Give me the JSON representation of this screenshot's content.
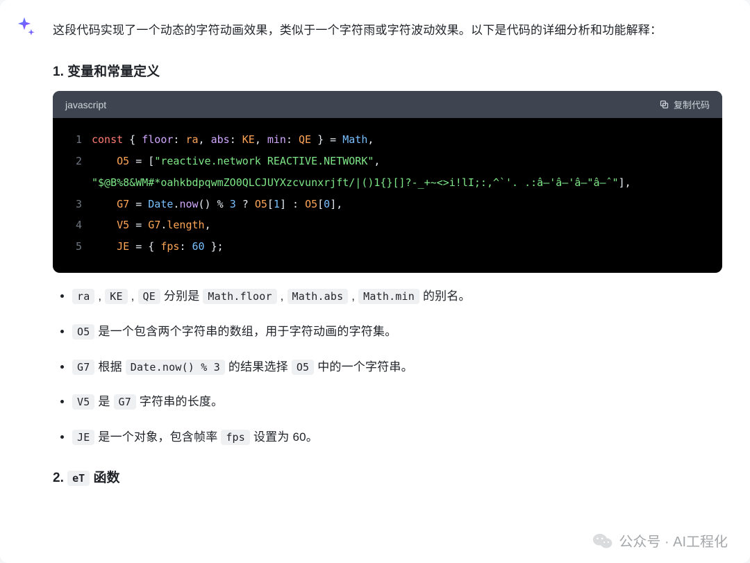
{
  "intro": "这段代码实现了一个动态的字符动画效果，类似于一个字符雨或字符波动效果。以下是代码的详细分析和功能解释：",
  "sections": {
    "s1": {
      "prefix": "1. ",
      "title": "变量和常量定义"
    },
    "s2": {
      "prefix": "2. ",
      "code": "eT",
      "suffix": " 函数"
    }
  },
  "code": {
    "lang": "javascript",
    "copy_label": "复制代码",
    "lines": {
      "l1": {
        "n": "1"
      },
      "l2": {
        "n": "2"
      },
      "l3": {
        "n": "3"
      },
      "l4": {
        "n": "4"
      },
      "l5": {
        "n": "5"
      }
    },
    "tokens": {
      "const": "const",
      "lbrace_sp": " { ",
      "floor": "floor",
      "colon_sp": ": ",
      "ra": "ra",
      "comma_sp": ", ",
      "abs": "abs",
      "KE": "KE",
      "min": "min",
      "QE": "QE",
      "rbrace_eq": " } = ",
      "Math": "Math",
      "comma_nl": ",",
      "indent4": "    ",
      "O5": "O5",
      "eq": " = ",
      "lbrk": "[",
      "str1": "\"reactive.network REACTIVE.NETWORK\"",
      "str2": "\"$@B%8&WM#*oahkbdpqwmZO0QLCJUYXzcvunxrjft/|()1{}[]?-_+~<>i!lI;:,^`'. .:â–'â–'â–\"â–ˆ\"",
      "rbrk_comma": "],",
      "G7": "G7",
      "Date": "Date",
      "dot": ".",
      "now": "now",
      "parens": "()",
      "mod": " % ",
      "three": "3",
      "qmark": " ? ",
      "one": "1",
      "zero": "0",
      "rbrk": "]",
      "colon_tern": " : ",
      "V5": "V5",
      "length": "length",
      "JE": "JE",
      "lbrace2": "{ ",
      "fps": "fps",
      "sixty": "60",
      "rbrace_semi": " };"
    }
  },
  "bullets": {
    "b1": {
      "c1": "ra",
      "t1": " , ",
      "c2": "KE",
      "t2": " , ",
      "c3": "QE",
      "t3": " 分别是 ",
      "c4": "Math.floor",
      "t4": " , ",
      "c5": "Math.abs",
      "t5": " , ",
      "c6": "Math.min",
      "t6": " 的别名。"
    },
    "b2": {
      "c1": "O5",
      "t1": " 是一个包含两个字符串的数组，用于字符动画的字符集。"
    },
    "b3": {
      "c1": "G7",
      "t1": " 根据 ",
      "c2": "Date.now() % 3",
      "t2": " 的结果选择 ",
      "c3": "O5",
      "t3": " 中的一个字符串。"
    },
    "b4": {
      "c1": "V5",
      "t1": " 是 ",
      "c2": "G7",
      "t2": " 字符串的长度。"
    },
    "b5": {
      "c1": "JE",
      "t1": " 是一个对象，包含帧率 ",
      "c2": "fps",
      "t2": " 设置为 60。"
    }
  },
  "footer": {
    "text": "公众号 · AI工程化"
  }
}
